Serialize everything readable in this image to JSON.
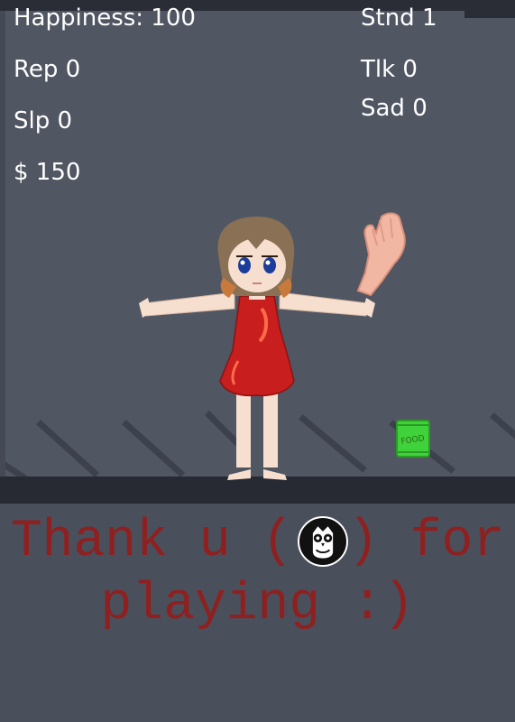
{
  "hud": {
    "happiness": "Happiness: 100",
    "rep": "Rep 0",
    "slp": "Slp 0",
    "money": "$ 150",
    "stnd": "Stnd 1",
    "tlk": "Tlk 0",
    "sad": "Sad 0"
  },
  "items": {
    "food_label": "FOOD"
  },
  "message": {
    "line1_before_badge": "Thank u (",
    "line1_after_badge": ") for",
    "line2": "playing :)"
  },
  "colors": {
    "background": "#4b505d",
    "floor": "#272933",
    "message_text": "#8f2020",
    "hud_text": "#ffffff",
    "dress": "#c81e1e",
    "food_bag": "#3fd23a"
  },
  "icons": {
    "badge": "owl-icon",
    "hand": "hand-icon",
    "food": "food-bag-icon"
  }
}
